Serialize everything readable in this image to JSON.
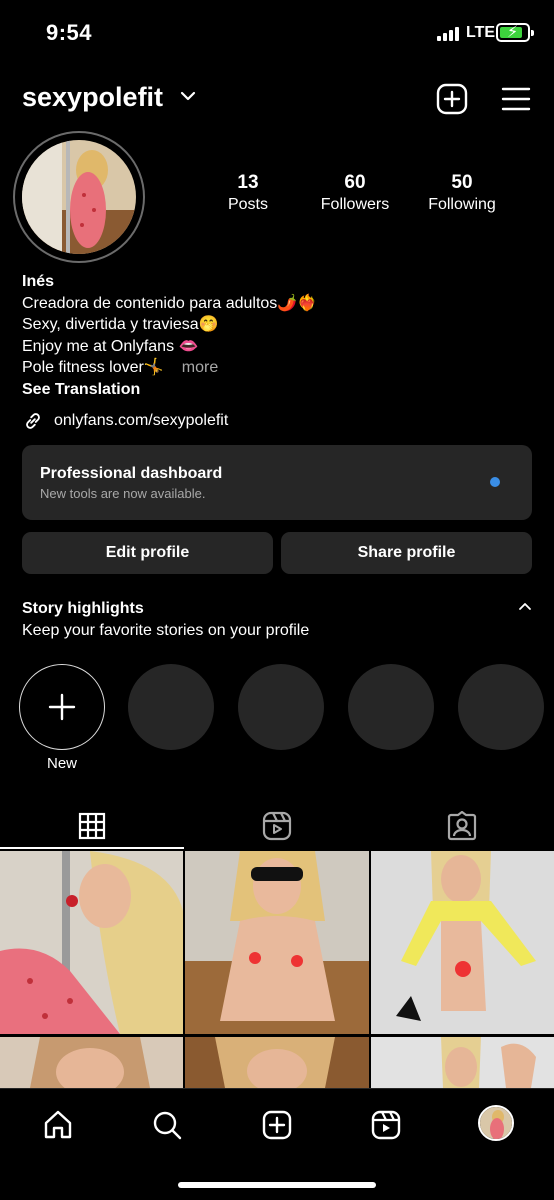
{
  "status_bar": {
    "time": "9:54",
    "network": "LTE"
  },
  "header": {
    "username": "sexypolefit"
  },
  "stats": [
    {
      "value": "13",
      "label": "Posts"
    },
    {
      "value": "60",
      "label": "Followers"
    },
    {
      "value": "50",
      "label": "Following"
    }
  ],
  "bio": {
    "name": "Inés",
    "line1": "Creadora de contenido para adultos🌶️❤️‍🔥",
    "line2": "Sexy, divertida y traviesa🤭",
    "line3": "Enjoy me at Onlyfans 👄",
    "line4": "Pole fitness lover🤸",
    "more": "more",
    "see_translation": "See Translation"
  },
  "link": "onlyfans.com/sexypolefit",
  "dashboard": {
    "title": "Professional dashboard",
    "subtitle": "New tools are now available."
  },
  "buttons": {
    "edit": "Edit profile",
    "share": "Share profile"
  },
  "highlights": {
    "title": "Story highlights",
    "subtitle": "Keep your favorite stories on your profile",
    "new_label": "New"
  },
  "tabs": [
    "grid-icon",
    "reels-icon",
    "tagged-icon"
  ],
  "nav": [
    "home-icon",
    "search-icon",
    "create-icon",
    "reels-icon",
    "profile-avatar"
  ],
  "colors": {
    "background": "#000000",
    "surface": "#262626",
    "accent_dot": "#3a8ee6",
    "battery": "#3dd33d"
  }
}
